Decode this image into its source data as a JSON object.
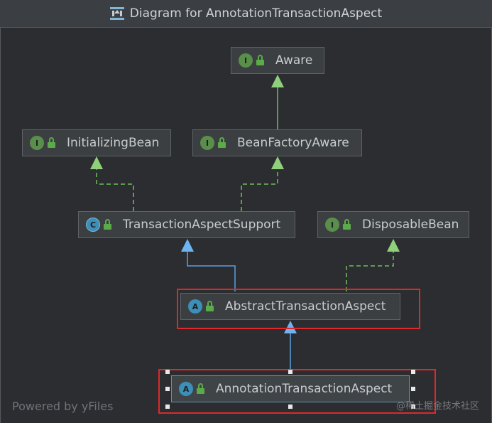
{
  "window": {
    "title": "Diagram for AnnotationTransactionAspect"
  },
  "nodes": {
    "aware": {
      "label": "Aware",
      "kind": "I"
    },
    "initializing_bean": {
      "label": "InitializingBean",
      "kind": "I"
    },
    "bean_factory_aware": {
      "label": "BeanFactoryAware",
      "kind": "I"
    },
    "transaction_aspect_support": {
      "label": "TransactionAspectSupport",
      "kind": "C"
    },
    "disposable_bean": {
      "label": "DisposableBean",
      "kind": "I"
    },
    "abstract_transaction_aspect": {
      "label": "AbstractTransactionAspect",
      "kind": "A"
    },
    "annotation_transaction_aspect": {
      "label": "AnnotationTransactionAspect",
      "kind": "A"
    }
  },
  "footer": {
    "powered_by": "Powered by yFiles"
  },
  "watermark": {
    "text": "@稀土掘金技术社区"
  },
  "colors": {
    "background": "#2b2d30",
    "node_fill": "#3c3f41",
    "implements_edge": "#6fbf5f",
    "extends_edge": "#5aa0e0",
    "highlight_box": "#e0272a"
  }
}
